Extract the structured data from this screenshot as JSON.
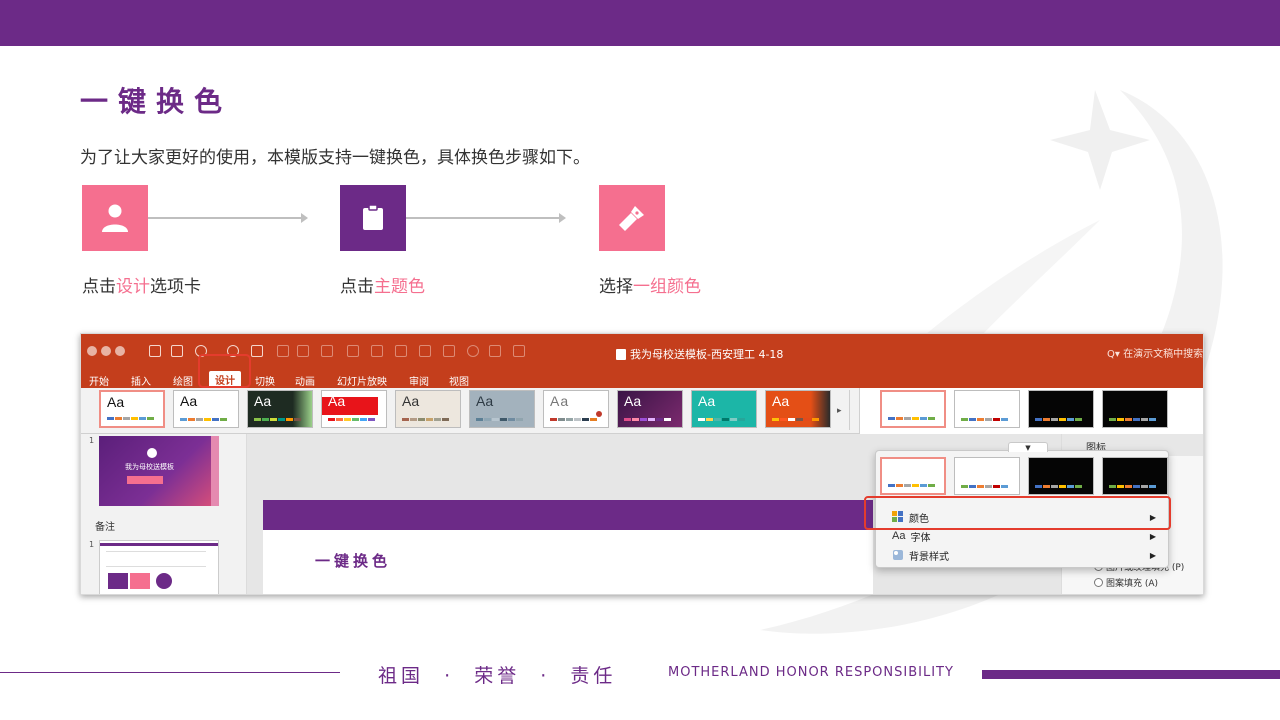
{
  "slide": {
    "title": "一键换色",
    "intro": "为了让大家更好的使用，本模版支持一键换色，具体换色步骤如下。",
    "accent": "#6c2a87",
    "highlight": "#f56f8f"
  },
  "steps": [
    {
      "pre": "点击",
      "hl": "设计",
      "post": "选项卡",
      "icon": "user-icon"
    },
    {
      "pre": "点击",
      "hl": "主题色",
      "post": "",
      "icon": "clipboard-icon"
    },
    {
      "pre": "选择",
      "hl": "一组颜色",
      "post": "",
      "icon": "flashlight-icon"
    }
  ],
  "app": {
    "doc_title": "我为母校送模板-西安理工 4-18",
    "search_placeholder": "在演示文稿中搜索",
    "tabs": [
      "开始",
      "插入",
      "绘图",
      "设计",
      "切换",
      "动画",
      "幻灯片放映",
      "审阅",
      "视图"
    ],
    "active_tab": "设计",
    "theme_label": "Aa",
    "pane_heading": "图标",
    "notes_label": "备注",
    "slide_thumb_text": "我为母校送模板",
    "canvas_title": "一键换色",
    "radio_options": [
      "图片或纹理填充 (P)",
      "图案填充 (A)"
    ],
    "menu": {
      "items": [
        {
          "label": "颜色",
          "icon": "palette-icon"
        },
        {
          "label": "字体",
          "icon": "font-icon",
          "prefix": "Aa"
        },
        {
          "label": "背景样式",
          "icon": "background-icon"
        }
      ]
    }
  },
  "footer": {
    "cn": "祖国  ·  荣誉  ·  责任",
    "en": "MOTHERLAND HONOR RESPONSIBILITY"
  }
}
